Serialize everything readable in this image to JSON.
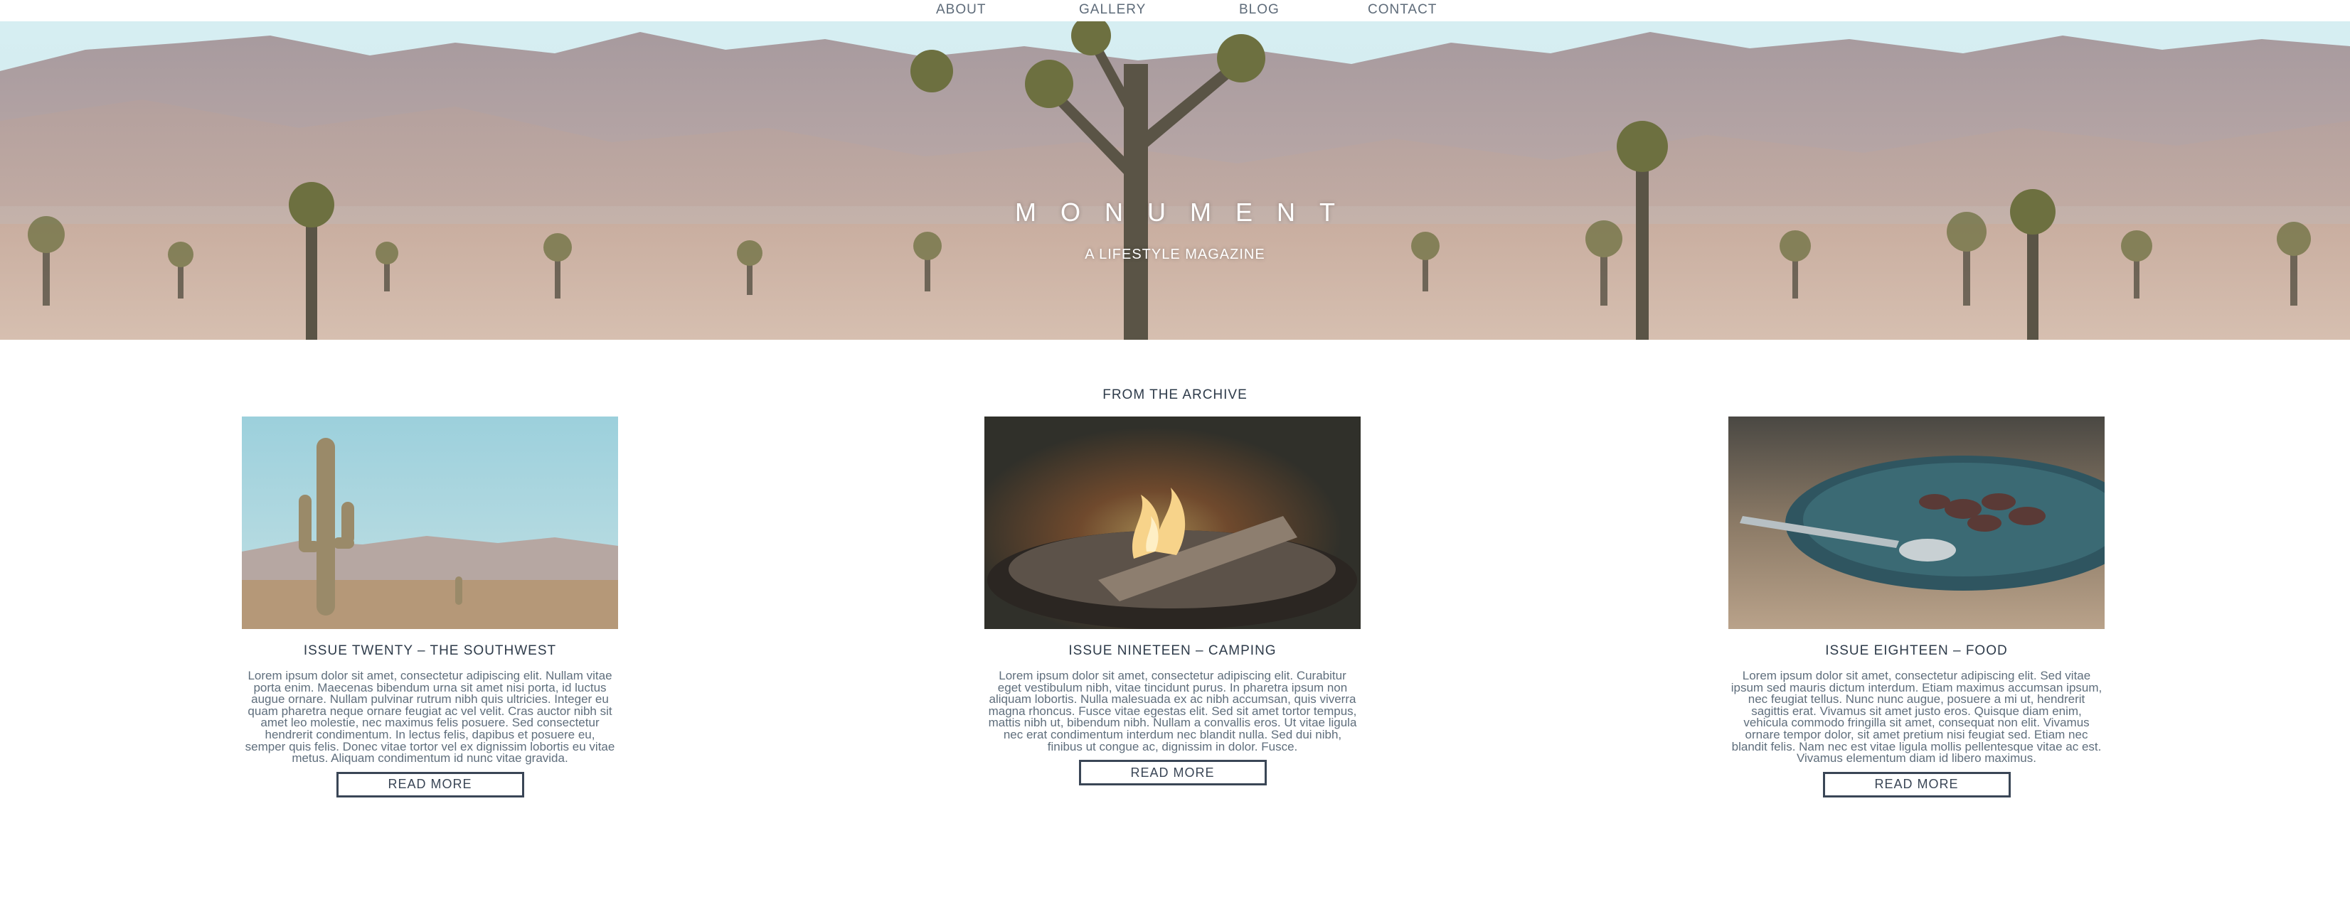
{
  "nav": {
    "items": [
      "ABOUT",
      "GALLERY",
      "BLOG",
      "CONTACT"
    ]
  },
  "hero": {
    "title": "MONUMENT",
    "subtitle": "A LIFESTYLE MAGAZINE"
  },
  "archive": {
    "heading": "FROM THE ARCHIVE",
    "cards": [
      {
        "title": "ISSUE TWENTY – THE SOUTHWEST",
        "text": "Lorem ipsum dolor sit amet, consectetur adipiscing elit. Nullam vitae porta enim. Maecenas bibendum urna sit amet nisi porta, id luctus augue ornare. Nullam pulvinar rutrum nibh quis ultricies. Integer eu quam pharetra neque ornare feugiat ac vel velit. Cras auctor nibh sit amet leo molestie, nec maximus felis posuere. Sed consectetur hendrerit condimentum. In lectus felis, dapibus et posuere eu, semper quis felis. Donec vitae tortor vel ex dignissim lobortis eu vitae metus. Aliquam condimentum id nunc vitae gravida.",
        "button": "READ MORE",
        "image_icon": "saguaro-cactus-photo"
      },
      {
        "title": "ISSUE NINETEEN – CAMPING",
        "text": "Lorem ipsum dolor sit amet, consectetur adipiscing elit. Curabitur eget vestibulum nibh, vitae tincidunt purus. In pharetra ipsum non aliquam lobortis. Nulla malesuada ex ac nibh accumsan, quis viverra magna rhoncus. Fusce vitae egestas elit. Sed sit amet tortor tempus, mattis nibh ut, bibendum nibh. Nullam a convallis eros. Ut vitae ligula nec erat condimentum interdum nec blandit nulla. Sed dui nibh, finibus ut congue ac, dignissim in dolor. Fusce.",
        "button": "READ MORE",
        "image_icon": "campfire-photo"
      },
      {
        "title": "ISSUE EIGHTEEN – FOOD",
        "text": "Lorem ipsum dolor sit amet, consectetur adipiscing elit. Sed vitae ipsum sed mauris dictum interdum. Etiam maximus accumsan ipsum, nec feugiat tellus. Nunc nunc augue, posuere a mi ut, hendrerit sagittis erat. Vivamus sit amet justo eros. Quisque diam enim, vehicula commodo fringilla sit amet, consequat non elit. Vivamus ornare tempor dolor, sit amet pretium nisi feugiat sed. Etiam nec blandit felis. Nam nec est vitae ligula mollis pellentesque vitae ac est. Vivamus elementum diam id libero maximus.",
        "button": "READ MORE",
        "image_icon": "food-plate-photo"
      }
    ]
  },
  "colors": {
    "text_dark": "#2e3b4a",
    "text_muted": "#5f6e7c",
    "button_border": "#3a4656",
    "sky": "#cfe8ec"
  }
}
